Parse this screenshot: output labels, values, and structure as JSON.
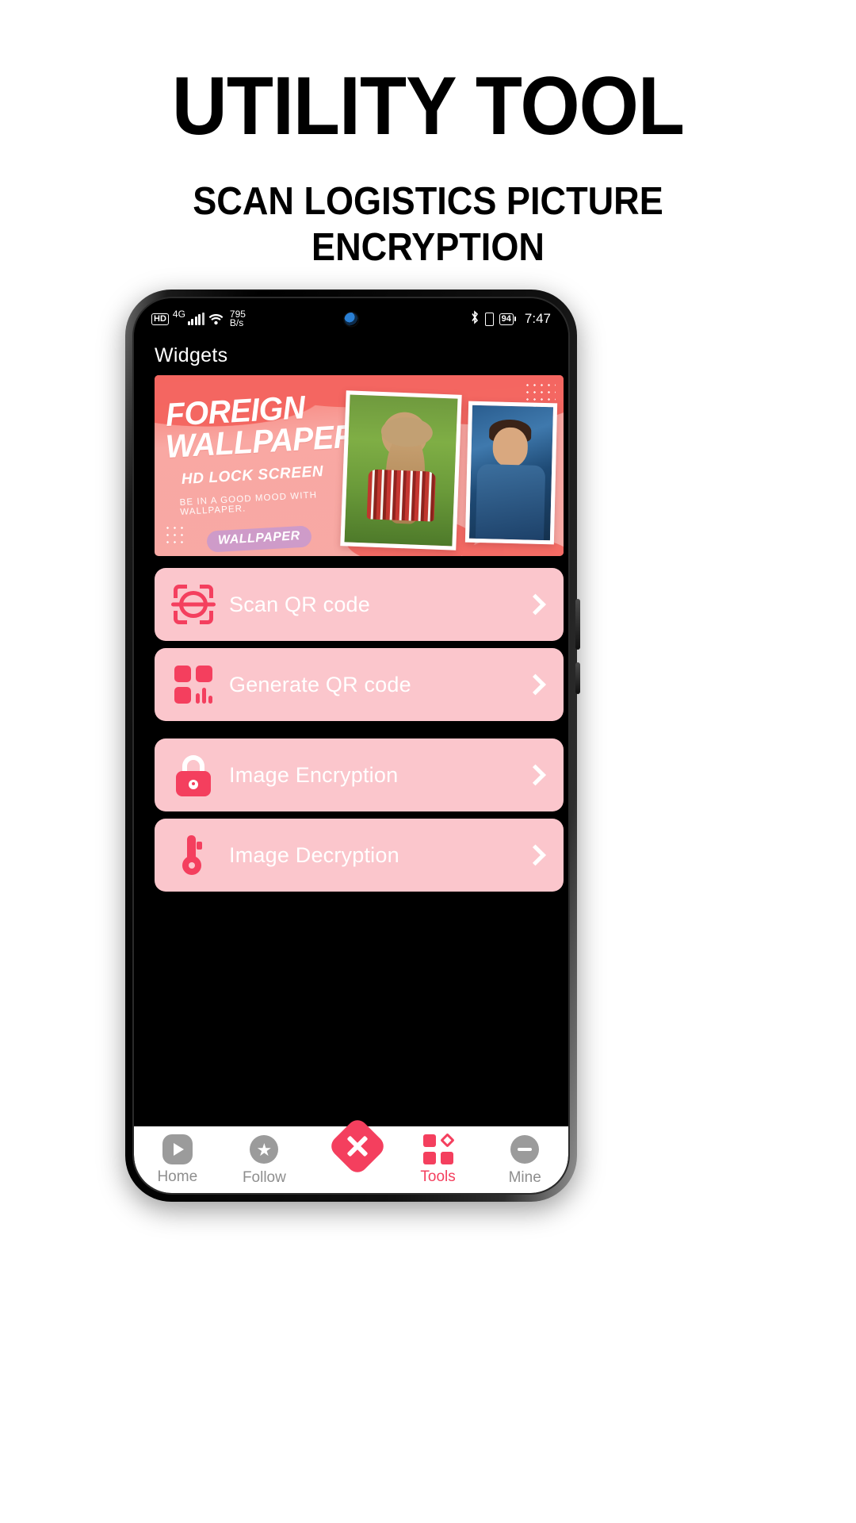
{
  "poster": {
    "headline": "UTILITY TOOL",
    "subheadline_line1": "SCAN LOGISTICS PICTURE",
    "subheadline_line2": "ENCRYPTION"
  },
  "status_bar": {
    "hd_label": "HD",
    "network_generation": "4G",
    "network_speed_value": "795",
    "network_speed_unit": "B/s",
    "battery_level": "94",
    "time": "7:47",
    "icons": [
      "hd-badge",
      "signal-bars-icon",
      "wifi-icon",
      "bluetooth-icon",
      "vibrate-icon",
      "battery-icon"
    ]
  },
  "app": {
    "title": "Widgets",
    "banner": {
      "line1": "FOREIGN",
      "line2": "WALLPAPER",
      "line3": "HD LOCK SCREEN",
      "line4": "BE IN A GOOD MOOD WITH WALLPAPER.",
      "chip": "WALLPAPER"
    },
    "rows": [
      {
        "label": "Scan QR code",
        "icon": "scan-qr-icon"
      },
      {
        "label": "Generate QR code",
        "icon": "generate-qr-icon"
      },
      {
        "label": "Image Encryption",
        "icon": "lock-icon"
      },
      {
        "label": "Image Decryption",
        "icon": "key-icon"
      }
    ],
    "bottom_nav": {
      "items": [
        {
          "label": "Home",
          "icon": "play-icon",
          "active": false
        },
        {
          "label": "Follow",
          "icon": "star-icon",
          "active": false
        },
        {
          "label": "",
          "icon": "plus-icon",
          "active": false
        },
        {
          "label": "Tools",
          "icon": "grid-icon",
          "active": true
        },
        {
          "label": "Mine",
          "icon": "person-icon",
          "active": false
        }
      ]
    }
  },
  "colors": {
    "accent": "#f43f5e",
    "row_background": "#fbc6cc",
    "screen_background": "#000000",
    "nav_inactive": "#8e8e8e",
    "page_background": "#ffffff"
  }
}
